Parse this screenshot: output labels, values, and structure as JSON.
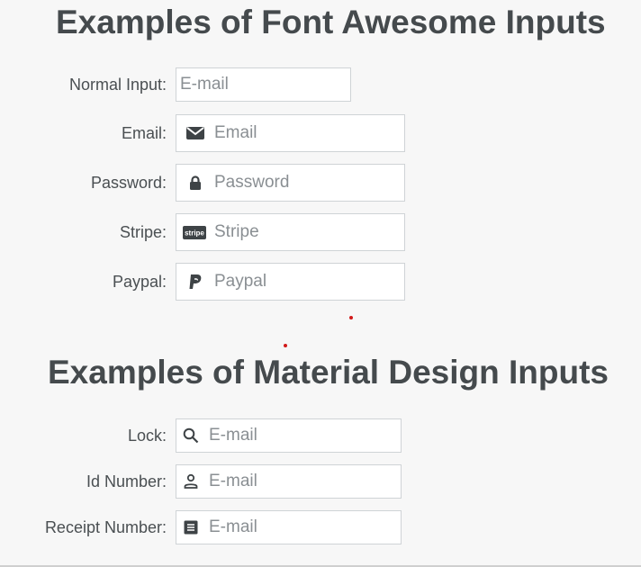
{
  "sections": {
    "font_awesome": {
      "title": "Examples of Font Awesome Inputs",
      "rows": [
        {
          "label": "Normal Input:",
          "placeholder": "E-mail",
          "icon": "none"
        },
        {
          "label": "Email:",
          "placeholder": "Email",
          "icon": "envelope-icon"
        },
        {
          "label": "Password:",
          "placeholder": "Password",
          "icon": "lock-icon"
        },
        {
          "label": "Stripe:",
          "placeholder": "Stripe",
          "icon": "stripe-icon",
          "icon_text": "stripe"
        },
        {
          "label": "Paypal:",
          "placeholder": "Paypal",
          "icon": "paypal-icon"
        }
      ]
    },
    "material_design": {
      "title": "Examples of Material Design Inputs",
      "rows": [
        {
          "label": "Lock:",
          "placeholder": "E-mail",
          "icon": "search-icon"
        },
        {
          "label": "Id Number:",
          "placeholder": "E-mail",
          "icon": "person-icon"
        },
        {
          "label": "Receipt Number:",
          "placeholder": "E-mail",
          "icon": "receipt-icon"
        }
      ]
    }
  },
  "colors": {
    "background": "#f7f7f7",
    "heading": "#454a4d",
    "input_border": "#cfd3d6",
    "placeholder": "#8a8f93",
    "marker_dot": "#d11a1a"
  }
}
